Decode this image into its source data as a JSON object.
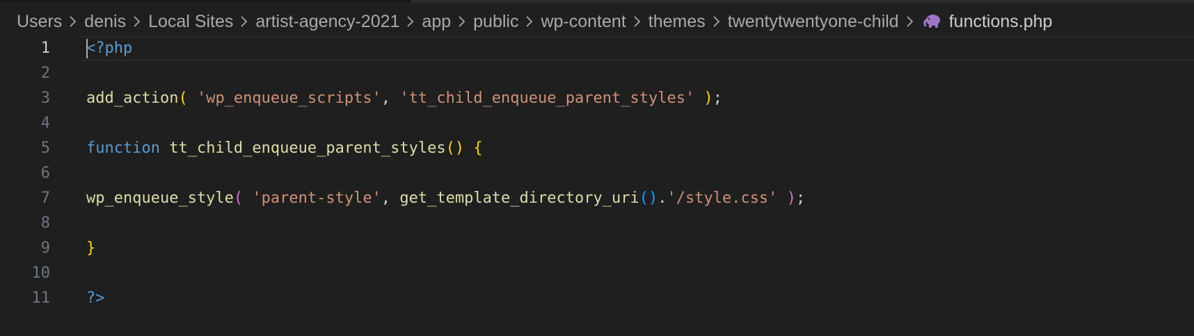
{
  "breadcrumb": {
    "segments": [
      "Users",
      "denis",
      "Local Sites",
      "artist-agency-2021",
      "app",
      "public",
      "wp-content",
      "themes",
      "twentytwentyone-child"
    ],
    "file": "functions.php",
    "file_icon": "php-elephant-icon",
    "separator_icon": "chevron-right-icon"
  },
  "colors": {
    "background": "#1f1f1f",
    "keyword": "#569cd6",
    "function": "#dcdcaa",
    "string": "#ce9178",
    "bracket_level1": "#ffd700",
    "bracket_level2": "#da70d6",
    "bracket_level3": "#179fff",
    "line_number": "#6e7681",
    "php_icon": "#a074c4"
  },
  "editor": {
    "current_line": 1,
    "lines": [
      {
        "num": "1",
        "tokens": [
          {
            "t": "<?php",
            "c": "tag"
          }
        ]
      },
      {
        "num": "2",
        "tokens": []
      },
      {
        "num": "3",
        "tokens": [
          {
            "t": "add_action",
            "c": "fn"
          },
          {
            "t": "(",
            "c": "p1"
          },
          {
            "t": " ",
            "c": "punc"
          },
          {
            "t": "'wp_enqueue_scripts'",
            "c": "str"
          },
          {
            "t": ", ",
            "c": "punc"
          },
          {
            "t": "'tt_child_enqueue_parent_styles'",
            "c": "str"
          },
          {
            "t": " ",
            "c": "punc"
          },
          {
            "t": ")",
            "c": "p1"
          },
          {
            "t": ";",
            "c": "punc"
          }
        ]
      },
      {
        "num": "4",
        "tokens": []
      },
      {
        "num": "5",
        "tokens": [
          {
            "t": "function",
            "c": "kw"
          },
          {
            "t": " ",
            "c": "punc"
          },
          {
            "t": "tt_child_enqueue_parent_styles",
            "c": "fn"
          },
          {
            "t": "()",
            "c": "p1"
          },
          {
            "t": " ",
            "c": "punc"
          },
          {
            "t": "{",
            "c": "p1"
          }
        ]
      },
      {
        "num": "6",
        "tokens": []
      },
      {
        "num": "7",
        "tokens": [
          {
            "t": "wp_enqueue_style",
            "c": "fn"
          },
          {
            "t": "(",
            "c": "p2"
          },
          {
            "t": " ",
            "c": "punc"
          },
          {
            "t": "'parent-style'",
            "c": "str"
          },
          {
            "t": ", ",
            "c": "punc"
          },
          {
            "t": "get_template_directory_uri",
            "c": "fn"
          },
          {
            "t": "()",
            "c": "p3"
          },
          {
            "t": ".",
            "c": "punc"
          },
          {
            "t": "'/style.css'",
            "c": "str"
          },
          {
            "t": " ",
            "c": "punc"
          },
          {
            "t": ")",
            "c": "p2"
          },
          {
            "t": ";",
            "c": "punc"
          }
        ]
      },
      {
        "num": "8",
        "tokens": []
      },
      {
        "num": "9",
        "tokens": [
          {
            "t": "}",
            "c": "p1"
          }
        ]
      },
      {
        "num": "10",
        "tokens": []
      },
      {
        "num": "11",
        "tokens": [
          {
            "t": "?>",
            "c": "tag"
          }
        ]
      }
    ]
  }
}
